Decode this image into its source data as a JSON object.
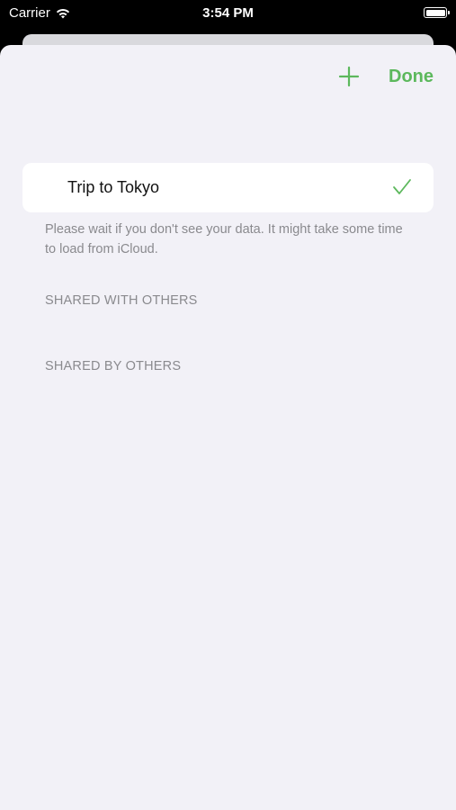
{
  "status_bar": {
    "carrier": "Carrier",
    "time": "3:54 PM",
    "icons": [
      "wifi-icon",
      "battery-icon"
    ]
  },
  "nav": {
    "add_icon": "plus-icon",
    "done_label": "Done",
    "accent_color": "#5cb85c"
  },
  "list": {
    "items": [
      {
        "label": "Trip to Tokyo",
        "selected": true,
        "icon": "checkmark-icon"
      }
    ],
    "footer": "Please wait if you don't see your data. It might take some time to load from iCloud."
  },
  "sections": {
    "shared_with_others": "SHARED WITH OTHERS",
    "shared_by_others": "SHARED BY OTHERS"
  }
}
